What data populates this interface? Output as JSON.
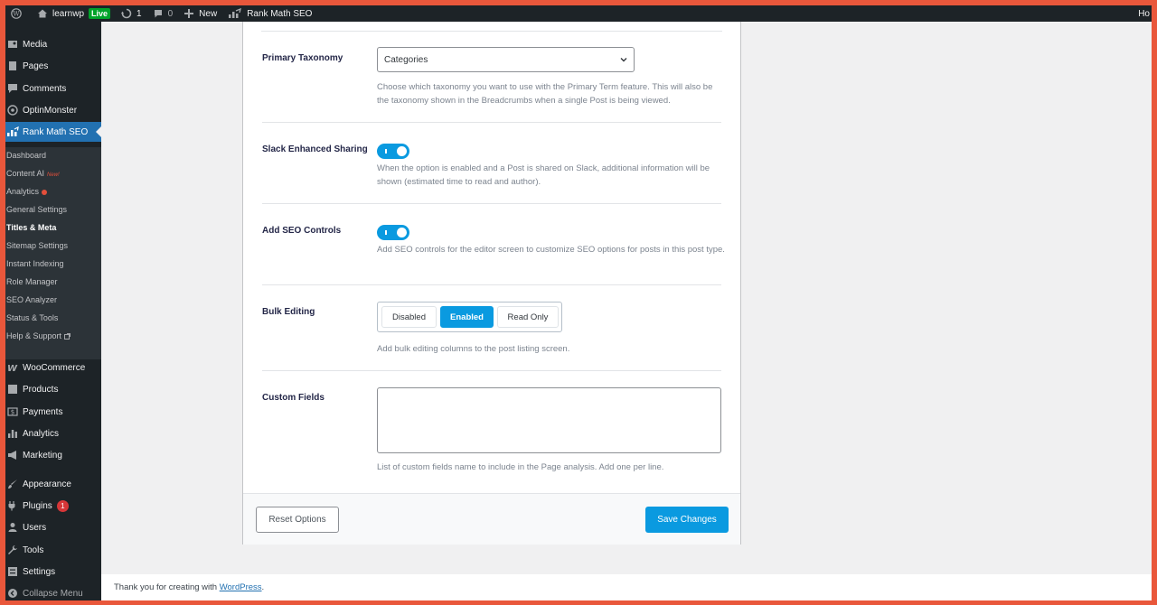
{
  "adminbar": {
    "site_name": "learnwp",
    "live_label": "Live",
    "updates_count": "1",
    "comments_count": "0",
    "new_label": "New",
    "rankmath_label": "Rank Math SEO",
    "right_text": "Ho"
  },
  "sidebar": {
    "top_items": [
      "Media",
      "Pages",
      "Comments",
      "OptinMonster"
    ],
    "active_item": "Rank Math SEO",
    "submenu": [
      "Dashboard",
      "Content AI",
      "Analytics",
      "General Settings",
      "Titles & Meta",
      "Sitemap Settings",
      "Instant Indexing",
      "Role Manager",
      "SEO Analyzer",
      "Status & Tools",
      "Help & Support"
    ],
    "new_tag": "New!",
    "bottom_items": [
      "WooCommerce",
      "Products",
      "Payments",
      "Analytics",
      "Marketing",
      "Appearance",
      "Plugins",
      "Users",
      "Tools",
      "Settings",
      "Collapse Menu"
    ],
    "plugins_badge": "1"
  },
  "settings": {
    "primary_taxonomy": {
      "label": "Primary Taxonomy",
      "selected": "Categories",
      "description": "Choose which taxonomy you want to use with the Primary Term feature. This will also be the taxonomy shown in the Breadcrumbs when a single Post is being viewed."
    },
    "slack_sharing": {
      "label": "Slack Enhanced Sharing",
      "enabled": true,
      "description": "When the option is enabled and a Post is shared on Slack, additional information will be shown (estimated time to read and author)."
    },
    "seo_controls": {
      "label": "Add SEO Controls",
      "enabled": true,
      "description": "Add SEO controls for the editor screen to customize SEO options for posts in this post type."
    },
    "bulk_editing": {
      "label": "Bulk Editing",
      "options": [
        "Disabled",
        "Enabled",
        "Read Only"
      ],
      "selected": "Enabled",
      "description": "Add bulk editing columns to the post listing screen."
    },
    "custom_fields": {
      "label": "Custom Fields",
      "value": "",
      "description": "List of custom fields name to include in the Page analysis. Add one per line."
    }
  },
  "actions": {
    "reset_label": "Reset Options",
    "save_label": "Save Changes"
  },
  "footer": {
    "text": "Thank you for creating with ",
    "link": "WordPress",
    "suffix": "."
  },
  "colors": {
    "accent": "#0a9ae0",
    "admin_dark": "#1d2327",
    "wp_blue": "#2271b1",
    "border_frame": "#e9573b"
  }
}
